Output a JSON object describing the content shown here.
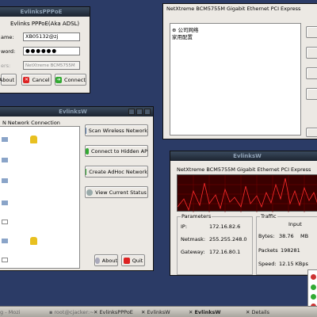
{
  "pppoe": {
    "title": "EvlinksPPPoE",
    "heading": "Evlinks PPPoE(Aka ADSL)",
    "username_label": "ame:",
    "username_value": "XB05132@zj",
    "password_label": "word:",
    "password_value": "●●●●●●",
    "adapter_label": "ers:",
    "adapter_value": "NetXtreme BCM5755M Gigabit",
    "about_label": "About",
    "cancel_label": "Cancel",
    "connect_label": "Connect"
  },
  "wireless": {
    "title": "EvlinksW",
    "list_header": "N Network Connection",
    "scan_label": "Scan Wireless Network",
    "hidden_label": "Connect to Hidden AP",
    "adhoc_label": "Create AdHoc Network",
    "status_label": "View Current Status",
    "about_label": "About",
    "quit_label": "Quit"
  },
  "top_right": {
    "title": "EvlinksW",
    "adapter": "NetXtreme BCM5755M Gigabit Ethernet PCI Express",
    "tree_items": [
      "公司网络",
      "家用配置"
    ]
  },
  "status": {
    "title": "EvlinksW",
    "adapter": "NetXtreme BCM5755M Gigabit Ethernet PCI Express",
    "params_title": "Parameters",
    "ip_label": "IP:",
    "ip_value": "172.16.82.6",
    "netmask_label": "Netmask:",
    "netmask_value": "255.255.248.0",
    "gateway_label": "Gateway:",
    "gateway_value": "172.16.80.1",
    "traffic_title": "Traffic",
    "input_label": "Input",
    "bytes_label": "Bytes:",
    "bytes_value": "38.76",
    "bytes_unit": "MB",
    "bytes_extra": "52",
    "packets_label": "Packets",
    "packets_value": "198281",
    "packets_extra": "59",
    "speed_label": "Speed:",
    "speed_value": "12.15 KBps",
    "speed_extra": "0."
  },
  "taskbar": {
    "items": [
      "g - Mozi",
      "root@cjacker:~",
      "EvlinksPPPoE",
      "EvlinksW",
      "EvlinksW",
      "Details"
    ]
  }
}
